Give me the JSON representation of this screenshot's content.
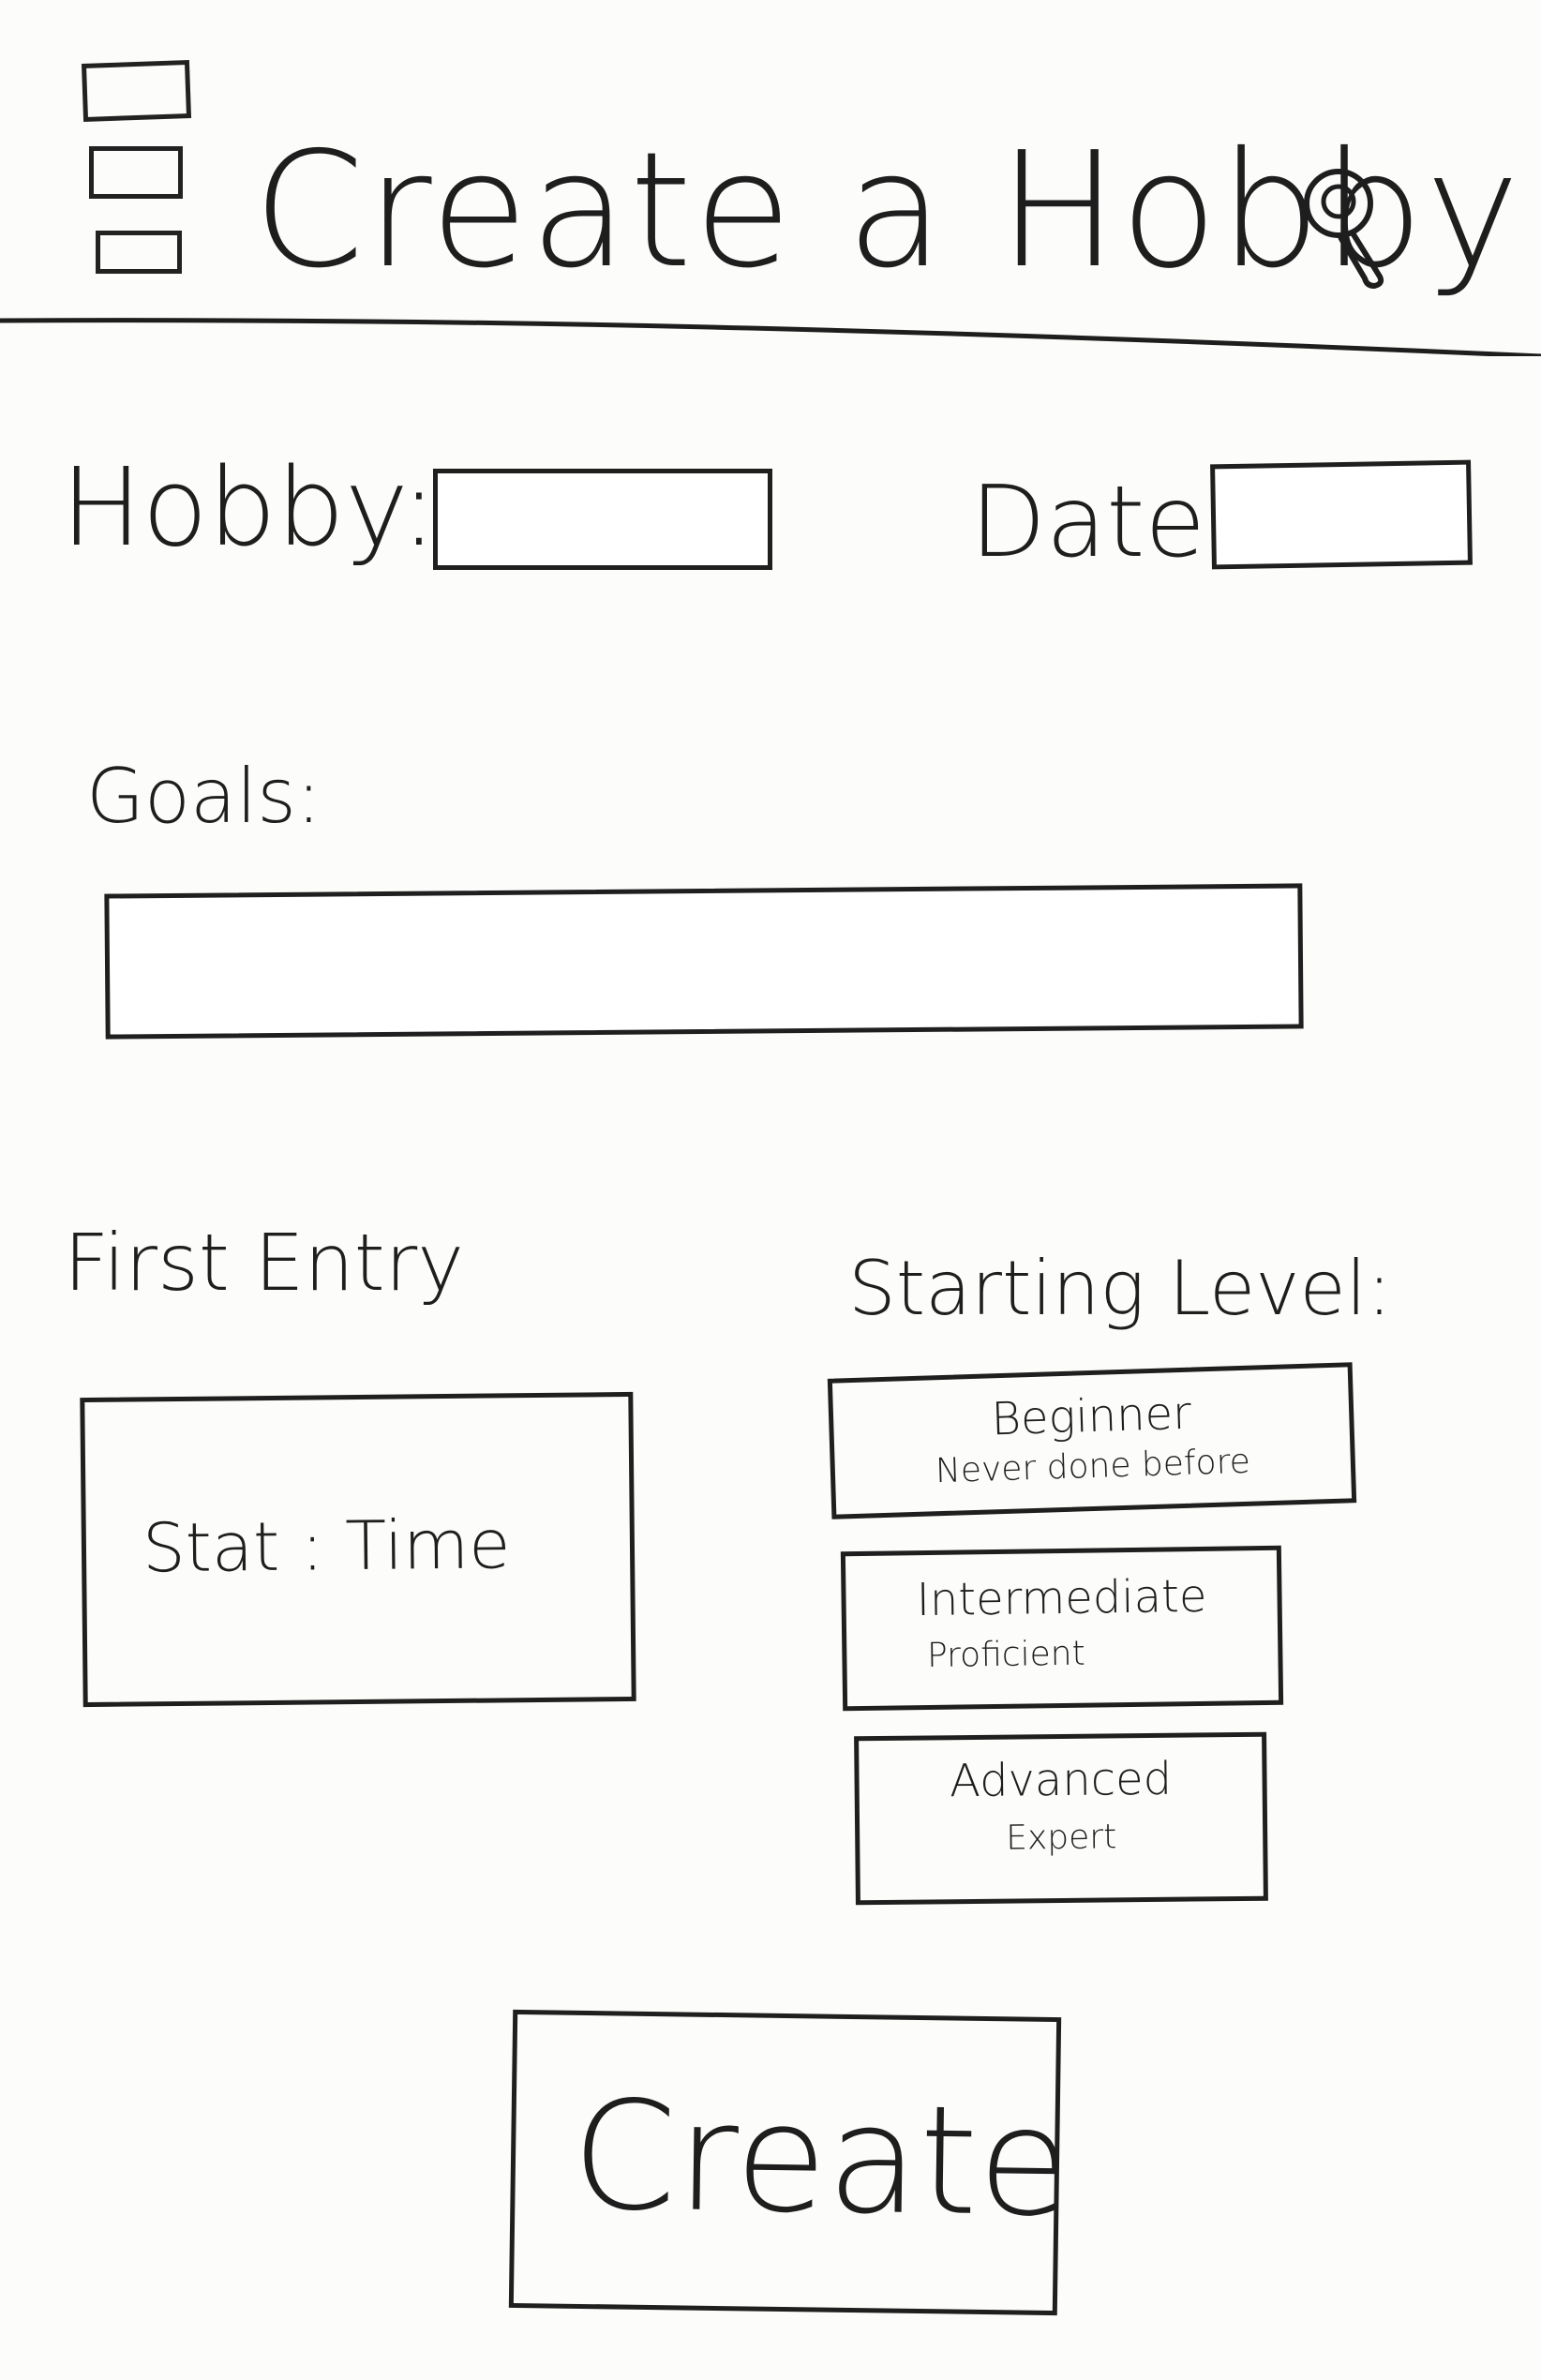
{
  "header": {
    "title": "Create a Hobby",
    "menu_icon": "hamburger-menu-icon",
    "search_icon": "search-icon"
  },
  "form": {
    "hobby_label": "Hobby:",
    "hobby_value": "",
    "date_label": "Date:",
    "date_value": "",
    "goals_label": "Goals:",
    "goals_value": ""
  },
  "first_entry": {
    "label": "First Entry",
    "stat_text": "Stat : Time"
  },
  "starting_level": {
    "label": "Starting Level:",
    "options": [
      {
        "title": "Beginner",
        "subtitle": "Never done before"
      },
      {
        "title": "Intermediate",
        "subtitle": "Proficient"
      },
      {
        "title": "Advanced",
        "subtitle": "Expert"
      }
    ]
  },
  "actions": {
    "create_label": "Create"
  }
}
